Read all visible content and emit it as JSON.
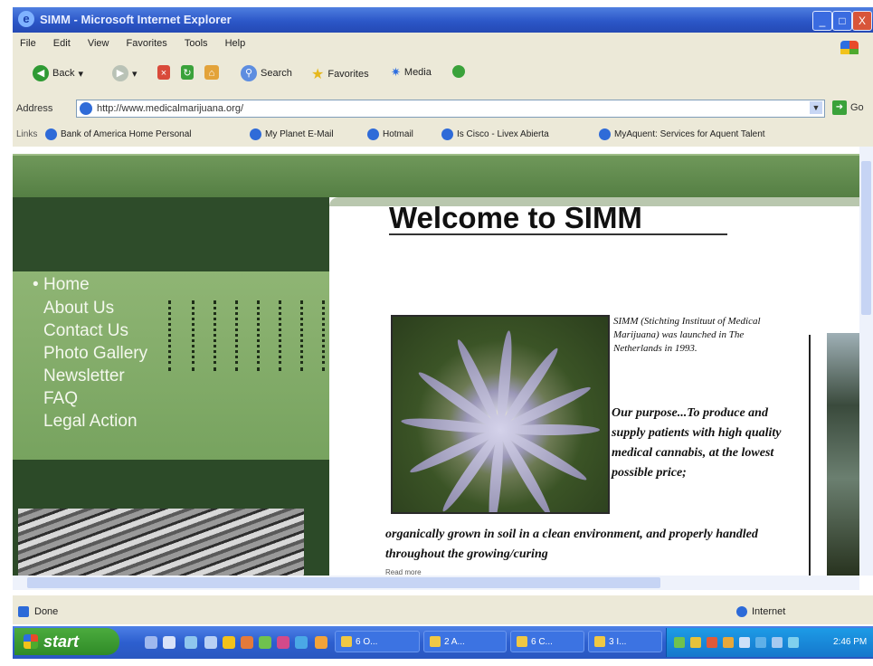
{
  "window": {
    "title": "SIMM - Microsoft Internet Explorer",
    "controls": [
      "_",
      "□",
      "X"
    ]
  },
  "menubar": {
    "items": [
      "File",
      "Edit",
      "View",
      "Favorites",
      "Tools",
      "Help"
    ]
  },
  "toolbar": {
    "back_label": "Back",
    "search_label": "Search",
    "favorites_label": "Favorites",
    "media_label": "Media"
  },
  "address": {
    "label": "Address",
    "url": "http://www.medicalmarijuana.org/",
    "go_label": "Go"
  },
  "links": {
    "label": "Links",
    "items": [
      "Bank of America Home Personal",
      "My Planet E-Mail",
      "Hotmail",
      "Is Cisco - Livex Abierta",
      "MyAquent: Services for Aquent Talent"
    ]
  },
  "page": {
    "welcome": "Welcome to SIMM",
    "nav": [
      "Home",
      "About Us",
      "Contact Us",
      "Photo Gallery",
      "Newsletter",
      "FAQ",
      "Legal Action"
    ],
    "intro": "SIMM (Stichting Instituut of Medical Marijuana) was launched in The Netherlands in 1993.",
    "purpose_lead": "Our purpose...To produce and supply patients with high quality medical cannabis, at the lowest possible price;",
    "purpose_rest": "organically grown in soil in a clean environment, and properly handled throughout the growing/curing",
    "small_text": "Read more"
  },
  "status": {
    "text": "Done",
    "zone": "Internet"
  },
  "taskbar": {
    "start_label": "start",
    "tasks": [
      "6 O...",
      "2 A...",
      "6 C...",
      "3 I..."
    ],
    "clock": "2:46 PM"
  }
}
